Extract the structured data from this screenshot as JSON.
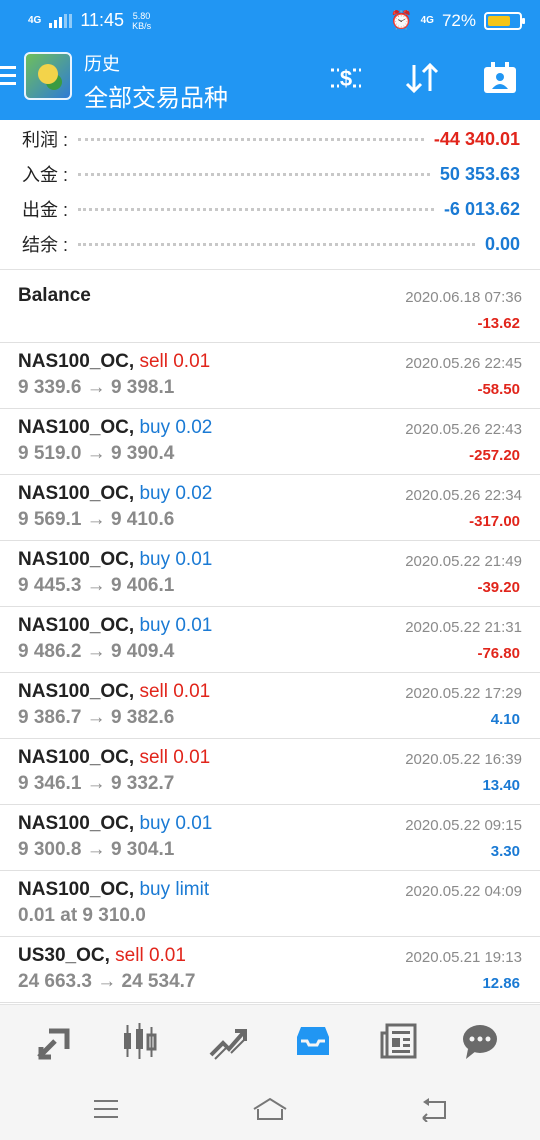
{
  "status_bar": {
    "network": "4G",
    "time": "11:45",
    "speed_value": "5.80",
    "speed_unit": "KB/s",
    "network2": "4G",
    "battery": "72%",
    "battery_level": 0.72
  },
  "header": {
    "subtitle": "历史",
    "title": "全部交易品种",
    "icons": [
      "menu-icon",
      "app-logo",
      "currency-exchange-icon",
      "sort-icon",
      "calendar-icon"
    ]
  },
  "summary": [
    {
      "label": "利润 :",
      "value": "-44 340.01",
      "color": "#e1251b"
    },
    {
      "label": "入金 :",
      "value": "50 353.63",
      "color": "#1a7ad4"
    },
    {
      "label": "出金 :",
      "value": "-6 013.62",
      "color": "#1a7ad4"
    },
    {
      "label": "结余 :",
      "value": "0.00",
      "color": "#1a7ad4"
    }
  ],
  "trades": [
    {
      "symbol": "Balance",
      "sep": "",
      "action": "",
      "action_color": "",
      "prices": "",
      "date": "2020.06.18 07:36",
      "profit": "-13.62",
      "profit_color": "#e1251b"
    },
    {
      "symbol": "NAS100_OC",
      "sep": ", ",
      "action": "sell 0.01",
      "action_color": "#e1251b",
      "prices": "9 339.6 → 9 398.1",
      "date": "2020.05.26 22:45",
      "profit": "-58.50",
      "profit_color": "#e1251b"
    },
    {
      "symbol": "NAS100_OC",
      "sep": ", ",
      "action": "buy 0.02",
      "action_color": "#1a7ad4",
      "prices": "9 519.0 → 9 390.4",
      "date": "2020.05.26 22:43",
      "profit": "-257.20",
      "profit_color": "#e1251b"
    },
    {
      "symbol": "NAS100_OC",
      "sep": ", ",
      "action": "buy 0.02",
      "action_color": "#1a7ad4",
      "prices": "9 569.1 → 9 410.6",
      "date": "2020.05.26 22:34",
      "profit": "-317.00",
      "profit_color": "#e1251b"
    },
    {
      "symbol": "NAS100_OC",
      "sep": ", ",
      "action": "buy 0.01",
      "action_color": "#1a7ad4",
      "prices": "9 445.3 → 9 406.1",
      "date": "2020.05.22 21:49",
      "profit": "-39.20",
      "profit_color": "#e1251b"
    },
    {
      "symbol": "NAS100_OC",
      "sep": ", ",
      "action": "buy 0.01",
      "action_color": "#1a7ad4",
      "prices": "9 486.2 → 9 409.4",
      "date": "2020.05.22 21:31",
      "profit": "-76.80",
      "profit_color": "#e1251b"
    },
    {
      "symbol": "NAS100_OC",
      "sep": ", ",
      "action": "sell 0.01",
      "action_color": "#e1251b",
      "prices": "9 386.7 → 9 382.6",
      "date": "2020.05.22 17:29",
      "profit": "4.10",
      "profit_color": "#1a7ad4"
    },
    {
      "symbol": "NAS100_OC",
      "sep": ", ",
      "action": "sell 0.01",
      "action_color": "#e1251b",
      "prices": "9 346.1 → 9 332.7",
      "date": "2020.05.22 16:39",
      "profit": "13.40",
      "profit_color": "#1a7ad4"
    },
    {
      "symbol": "NAS100_OC",
      "sep": ", ",
      "action": "buy 0.01",
      "action_color": "#1a7ad4",
      "prices": "9 300.8 → 9 304.1",
      "date": "2020.05.22 09:15",
      "profit": "3.30",
      "profit_color": "#1a7ad4"
    },
    {
      "symbol": "NAS100_OC",
      "sep": ", ",
      "action": "buy limit",
      "action_color": "#1a7ad4",
      "prices": "0.01 at 9 310.0",
      "date": "2020.05.22 04:09",
      "profit": "",
      "profit_color": "#1a7ad4"
    },
    {
      "symbol": "US30_OC",
      "sep": ", ",
      "action": "sell 0.01",
      "action_color": "#e1251b",
      "prices": "24 663.3 → 24 534.7",
      "date": "2020.05.21 19:13",
      "profit": "12.86",
      "profit_color": "#1a7ad4"
    }
  ],
  "bottom_nav": {
    "items": [
      "quotes-icon",
      "chart-icon",
      "trade-icon",
      "history-icon",
      "news-icon",
      "chat-icon"
    ],
    "active": "history-icon",
    "active_color": "#2196f3"
  },
  "system_nav": [
    "recents-icon",
    "home-icon",
    "back-icon"
  ]
}
